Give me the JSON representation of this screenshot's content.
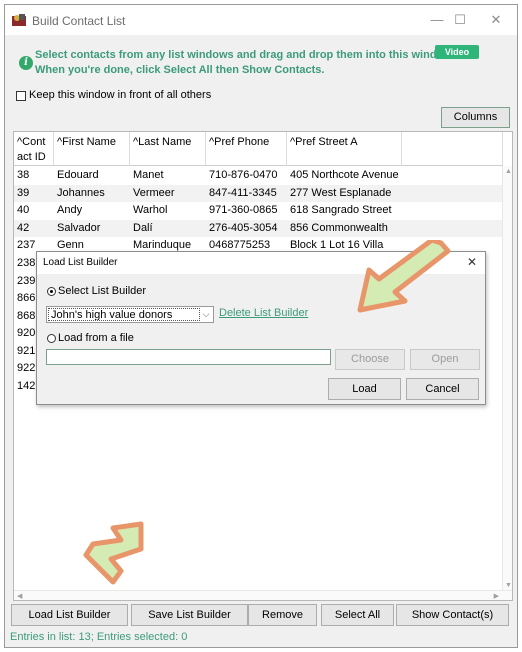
{
  "window": {
    "title": "Build Contact List",
    "minimize_glyph": "—",
    "maximize_glyph": "☐",
    "close_glyph": "✕"
  },
  "info": {
    "icon": "i",
    "line1": "Select contacts from any list windows and drag and drop them into this window.",
    "line2": "When you're done, click Select All then Show Contacts.",
    "video_label": "Video"
  },
  "keep_front": {
    "label": "Keep this window in front of all others",
    "checked": false
  },
  "columns_button": "Columns",
  "table": {
    "columns": [
      "^Cont act ID",
      "^First Name",
      "^Last Name",
      "^Pref Phone",
      "^Pref Street A"
    ],
    "rows": [
      [
        "38",
        "Edouard",
        "Manet",
        "710-876-0470",
        "405 Northcote Avenue"
      ],
      [
        "39",
        "Johannes",
        "Vermeer",
        "847-411-3345",
        "277 West Esplanade"
      ],
      [
        "40",
        "Andy",
        "Warhol",
        "971-360-0865",
        "618 Sangrado Street"
      ],
      [
        "42",
        "Salvador",
        "Dalí",
        "276-405-3054",
        "856 Commonwealth"
      ],
      [
        "237",
        "Genn",
        "Marinduque",
        "0468775253",
        "Block 1 Lot 16 Villa"
      ]
    ],
    "hidden_ids": [
      "238",
      "239",
      "866",
      "868",
      "920",
      "921",
      "922",
      "142"
    ]
  },
  "buttons": {
    "load_list_builder": "Load List Builder",
    "save_list_builder": "Save List Builder",
    "remove": "Remove",
    "select_all": "Select All",
    "show_contacts": "Show Contact(s)"
  },
  "status": "Entries in list: 13; Entries selected: 0",
  "dialog": {
    "title": "Load List Builder",
    "close_glyph": "✕",
    "select_radio_label": "Select List Builder",
    "selected_builder": "John's high value donors",
    "delete_link": "Delete List Builder",
    "file_radio_label": "Load from a file",
    "file_path": "",
    "choose_label": "Choose",
    "open_label": "Open",
    "load_label": "Load",
    "cancel_label": "Cancel"
  },
  "colors": {
    "accent_text": "#3c9b7a",
    "video_button": "#2fb47a",
    "arrow_fill": "#d4ecb4",
    "arrow_outline": "#e8956a"
  }
}
